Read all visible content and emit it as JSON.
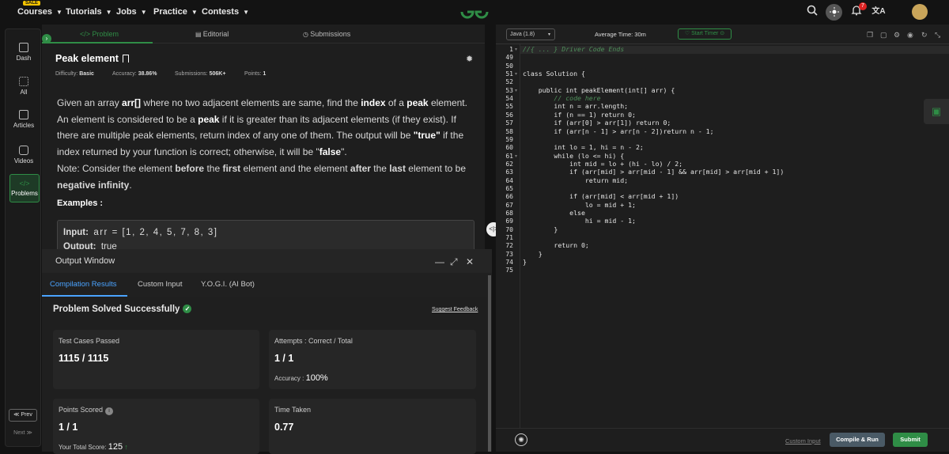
{
  "nav": {
    "items": [
      {
        "label": "Courses",
        "badge": "SALE"
      },
      {
        "label": "Tutorials"
      },
      {
        "label": "Jobs"
      },
      {
        "label": "Practice"
      },
      {
        "label": "Contests"
      }
    ],
    "notification_count": "7"
  },
  "sidebar": {
    "items": [
      {
        "label": "Dash",
        "icon": "dashboard-icon"
      },
      {
        "label": "All",
        "icon": "grid-icon"
      },
      {
        "label": "Articles",
        "icon": "book-icon"
      },
      {
        "label": "Videos",
        "icon": "video-icon"
      },
      {
        "label": "Problems",
        "icon": "code-icon",
        "active": true
      }
    ],
    "prev_label": "≪ Prev",
    "next_label": "Next ≫"
  },
  "problem_tabs": {
    "problem": "</> Problem",
    "editorial": "Editorial",
    "submissions": "Submissions"
  },
  "problem": {
    "title": "Peak element",
    "difficulty_label": "Difficulty:",
    "difficulty": "Basic",
    "accuracy_label": "Accuracy:",
    "accuracy": "38.86%",
    "submissions_label": "Submissions:",
    "submissions": "506K+",
    "points_label": "Points:",
    "points": "1",
    "desc_parts": [
      "Given an array ",
      "arr[]",
      " where no two adjacent elements are same, find the ",
      "index",
      " of a ",
      "peak",
      " element. An element is considered to be a ",
      "peak",
      " if it is greater than its adjacent elements (if they exist). If there are multiple peak elements, return index of any one of them. The output will be ",
      "\"true\"",
      " if the index returned by your function is correct; otherwise, it will be \"",
      "false",
      "\"."
    ],
    "note_parts": [
      "Note: Consider the element ",
      "before",
      " the ",
      "first",
      " element and the element ",
      "after",
      " the ",
      "last",
      " element to be ",
      "negative infinity",
      "."
    ],
    "examples_title": "Examples :",
    "example_input_label": "Input:",
    "example_input": "arr = [1, 2, 4, 5, 7, 8, 3]",
    "example_output_label": "Output:",
    "example_output": "true"
  },
  "output_window": {
    "title": "Output Window",
    "tabs": [
      "Compilation Results",
      "Custom Input",
      "Y.O.G.I. (AI Bot)"
    ],
    "status": "Problem Solved Successfully",
    "suggest_feedback": "Suggest Feedback",
    "cards": {
      "test_cases": {
        "label": "Test Cases Passed",
        "value": "1115 / 1115"
      },
      "attempts": {
        "label": "Attempts : Correct / Total",
        "value": "1 / 1",
        "sub_label": "Accuracy :",
        "sub_value": "100%"
      },
      "points": {
        "label": "Points Scored",
        "value": "1 / 1",
        "sub_label": "Your Total Score:",
        "sub_value": "125"
      },
      "time": {
        "label": "Time Taken",
        "value": "0.77"
      }
    }
  },
  "editor": {
    "language": "Java (1.8)",
    "average_time": "Average Time: 30m",
    "start_timer": "Start Timer",
    "lines": [
      {
        "n": "1",
        "text": "//{ ... } Driver Code Ends",
        "comment": true
      },
      {
        "n": "49",
        "text": ""
      },
      {
        "n": "50",
        "text": ""
      },
      {
        "n": "51",
        "text": "class Solution {"
      },
      {
        "n": "52",
        "text": ""
      },
      {
        "n": "53",
        "text": "    public int peakElement(int[] arr) {"
      },
      {
        "n": "54",
        "text": "        // code here",
        "comment": true
      },
      {
        "n": "55",
        "text": "        int n = arr.length;"
      },
      {
        "n": "56",
        "text": "        if (n == 1) return 0;"
      },
      {
        "n": "57",
        "text": "        if (arr[0] > arr[1]) return 0;"
      },
      {
        "n": "58",
        "text": "        if (arr[n - 1] > arr[n - 2])return n - 1;"
      },
      {
        "n": "59",
        "text": ""
      },
      {
        "n": "60",
        "text": "        int lo = 1, hi = n - 2;"
      },
      {
        "n": "61",
        "text": "        while (lo <= hi) {"
      },
      {
        "n": "62",
        "text": "            int mid = lo + (hi - lo) / 2;"
      },
      {
        "n": "63",
        "text": "            if (arr[mid] > arr[mid - 1] && arr[mid] > arr[mid + 1])"
      },
      {
        "n": "64",
        "text": "                return mid;"
      },
      {
        "n": "65",
        "text": ""
      },
      {
        "n": "66",
        "text": "            if (arr[mid] < arr[mid + 1])"
      },
      {
        "n": "67",
        "text": "                lo = mid + 1;"
      },
      {
        "n": "68",
        "text": "            else"
      },
      {
        "n": "69",
        "text": "                hi = mid - 1;"
      },
      {
        "n": "70",
        "text": "        }"
      },
      {
        "n": "71",
        "text": ""
      },
      {
        "n": "72",
        "text": "        return 0;"
      },
      {
        "n": "73",
        "text": "    }"
      },
      {
        "n": "74",
        "text": "}"
      },
      {
        "n": "75",
        "text": ""
      }
    ],
    "custom_input": "Custom Input",
    "compile_run": "Compile & Run",
    "submit": "Submit"
  },
  "colors": {
    "accent_green": "#2f8d46",
    "link_blue": "#4aa3ff",
    "background": "#131313"
  }
}
